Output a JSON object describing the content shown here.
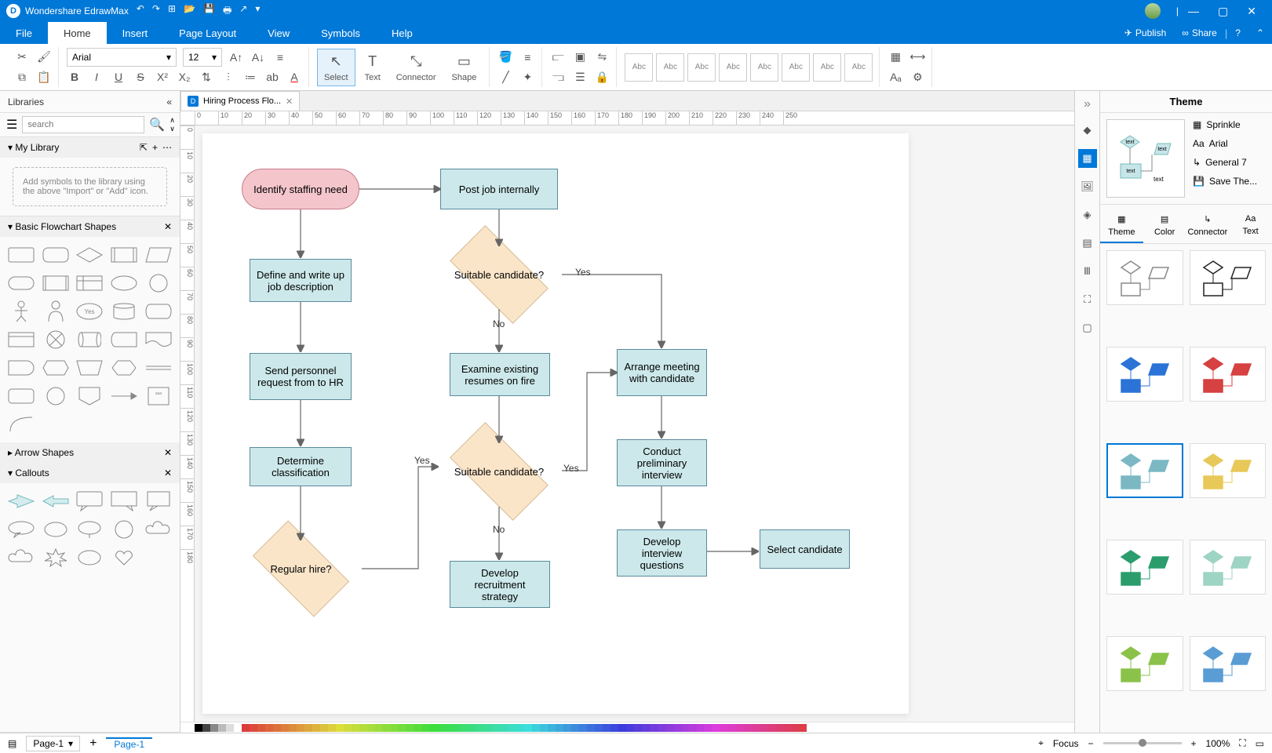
{
  "app": {
    "title": "Wondershare EdrawMax"
  },
  "menu": {
    "tabs": [
      "File",
      "Home",
      "Insert",
      "Page Layout",
      "View",
      "Symbols",
      "Help"
    ],
    "active": "Home",
    "publish": "Publish",
    "share": "Share"
  },
  "ribbon": {
    "font_name": "Arial",
    "font_size": "12",
    "tools": {
      "select": "Select",
      "text": "Text",
      "connector": "Connector",
      "shape": "Shape"
    },
    "style_label": "Abc"
  },
  "sidebar": {
    "title": "Libraries",
    "search_placeholder": "search",
    "mylib": "My Library",
    "mylib_hint": "Add symbols to the library using the above \"Import\" or \"Add\" icon.",
    "basic": "Basic Flowchart Shapes",
    "arrows": "Arrow Shapes",
    "callouts": "Callouts"
  },
  "doc": {
    "tab_name": "Hiring Process Flo..."
  },
  "flow": {
    "n1": "Identify staffing need",
    "n2": "Define and write up job description",
    "n3": "Send personnel request from to HR",
    "n4": "Determine classification",
    "n5": "Regular hire?",
    "n6": "Post job internally",
    "n7": "Suitable candidate?",
    "n8": "Examine existing resumes on fire",
    "n9": "Suitable candidate?",
    "n10": "Develop recruitment strategy",
    "n11": "Arrange meeting with candidate",
    "n12": "Conduct preliminary interview",
    "n13": "Develop interview questions",
    "n14": "Select candidate",
    "yes": "Yes",
    "no": "No"
  },
  "theme": {
    "title": "Theme",
    "sprinkle": "Sprinkle",
    "font": "Arial",
    "connector": "General 7",
    "save": "Save The...",
    "tabs": {
      "theme": "Theme",
      "color": "Color",
      "connector": "Connector",
      "text": "Text"
    },
    "preview_text": "text"
  },
  "status": {
    "page_label": "Page-1",
    "page_tab": "Page-1",
    "focus": "Focus",
    "zoom": "100%"
  },
  "ruler_h": [
    "0",
    "10",
    "20",
    "30",
    "40",
    "50",
    "60",
    "70",
    "80",
    "90",
    "100",
    "110",
    "120",
    "130",
    "140",
    "150",
    "160",
    "170",
    "180",
    "190",
    "200",
    "210",
    "220",
    "230",
    "240",
    "250"
  ],
  "ruler_v": [
    "0",
    "10",
    "20",
    "30",
    "40",
    "50",
    "60",
    "70",
    "80",
    "90",
    "100",
    "110",
    "120",
    "130",
    "140",
    "150",
    "160",
    "170",
    "180"
  ]
}
